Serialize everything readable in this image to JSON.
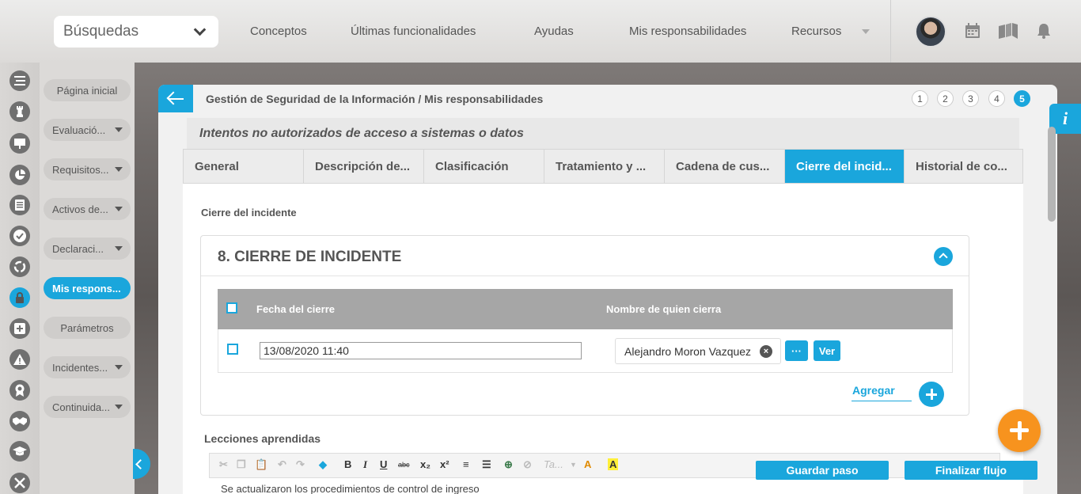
{
  "header": {
    "search_label": "Búsquedas",
    "nav": [
      "Conceptos",
      "Últimas funcionalidades",
      "Ayudas",
      "Mis responsabilidades",
      "Recursos"
    ]
  },
  "rail": {
    "icons": [
      "home-icon",
      "chart-icon",
      "list-icon",
      "chess-icon",
      "presentation-icon",
      "pie-icon",
      "document-icon",
      "check-icon",
      "cycle-icon",
      "lock-icon",
      "plus-icon",
      "warning-icon",
      "award-icon",
      "handshake-icon",
      "graduation-icon",
      "tools-icon"
    ]
  },
  "sidebar": {
    "items": [
      {
        "label": "Página inicial",
        "caret": false
      },
      {
        "label": "Evaluació...",
        "caret": true
      },
      {
        "label": "Requisitos...",
        "caret": true
      },
      {
        "label": "Activos de...",
        "caret": true
      },
      {
        "label": "Declaraci...",
        "caret": true
      },
      {
        "label": "Mis respons...",
        "caret": false,
        "active": true
      },
      {
        "label": "Parámetros",
        "caret": false
      },
      {
        "label": "Incidentes...",
        "caret": true
      },
      {
        "label": "Continuida...",
        "caret": true
      }
    ]
  },
  "panel": {
    "breadcrumb": "Gestión de Seguridad de la Información / Mis responsabilidades",
    "steps": [
      "1",
      "2",
      "3",
      "4",
      "5"
    ],
    "active_step": "5",
    "subtitle": "Intentos no autorizados de acceso a sistemas o datos",
    "tabs": [
      "General",
      "Descripción de...",
      "Clasificación",
      "Tratamiento y ...",
      "Cadena de cus...",
      "Cierre del incid...",
      "Historial de co..."
    ],
    "active_tab": 5,
    "section_title": "Cierre del incidente",
    "card_title": "8. CIERRE DE INCIDENTE",
    "grid": {
      "columns": [
        "Fecha del cierre",
        "Nombre de quien cierra"
      ],
      "rows": [
        {
          "fecha": "13/08/2020 11:40",
          "nombre": "Alejandro Moron Vazquez"
        }
      ],
      "more_label": "···",
      "ver_label": "Ver",
      "add_label": "Agregar"
    },
    "lessons_label": "Lecciones aprendidas",
    "editor_font_placeholder": "Ta...",
    "editor_text": "Se actualizaron los procedimientos de control de ingreso"
  },
  "actions": {
    "save_step": "Guardar paso",
    "finish_flow": "Finalizar flujo"
  },
  "colors": {
    "accent": "#1aa6dc",
    "fab": "#f7931e"
  }
}
